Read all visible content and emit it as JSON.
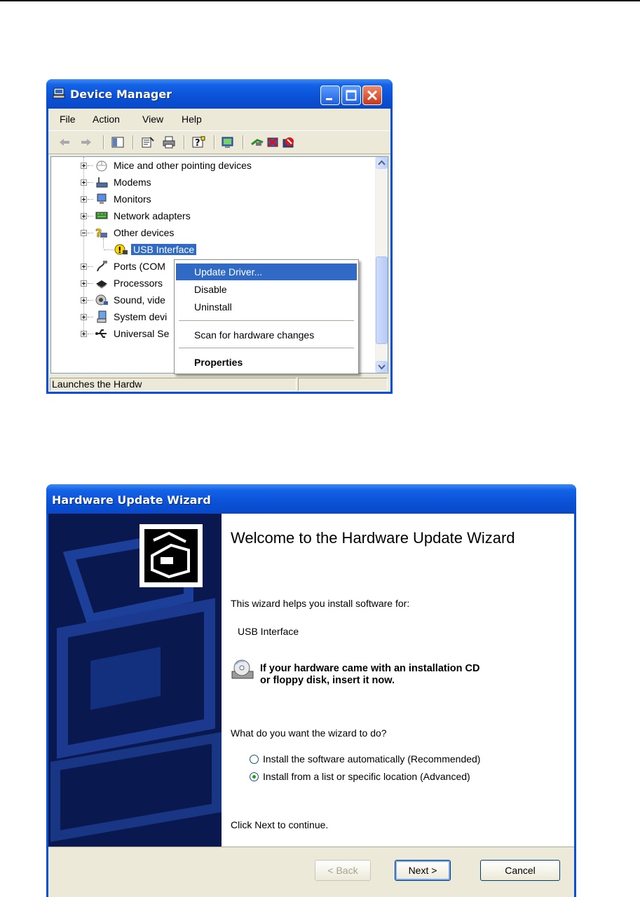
{
  "device_manager": {
    "title": "Device Manager",
    "menu": [
      "File",
      "Action",
      "View",
      "Help"
    ],
    "tree": [
      {
        "label": "Mice and other pointing devices",
        "icon": "mouse-icon"
      },
      {
        "label": "Modems",
        "icon": "modem-icon"
      },
      {
        "label": "Monitors",
        "icon": "monitor-icon"
      },
      {
        "label": "Network adapters",
        "icon": "network-adapter-icon"
      },
      {
        "label": "Other devices",
        "icon": "question-device-icon",
        "expanded": true
      },
      {
        "label": "USB Interface",
        "icon": "warning-device-icon",
        "child": true,
        "selected": true
      },
      {
        "label": "Ports (COM",
        "icon": "port-icon"
      },
      {
        "label": "Processors",
        "icon": "processor-icon"
      },
      {
        "label": "Sound, vide",
        "icon": "sound-icon"
      },
      {
        "label": "System devi",
        "icon": "system-device-icon"
      },
      {
        "label": "Universal Se",
        "icon": "usb-icon"
      }
    ],
    "status": "Launches the Hardw",
    "context_menu": {
      "items": [
        {
          "label": "Update Driver...",
          "highlighted": true
        },
        {
          "label": "Disable"
        },
        {
          "label": "Uninstall"
        },
        {
          "label": "Scan for hardware changes"
        },
        {
          "label": "Properties",
          "bold": true
        }
      ]
    }
  },
  "wizard": {
    "title": "Hardware Update Wizard",
    "heading": "Welcome to the Hardware Update Wizard",
    "intro": "This wizard helps you install software for:",
    "device": "USB Interface",
    "cd_line1": "If your hardware came with an installation CD",
    "cd_line2": "or floppy disk, insert it now.",
    "question": "What do you want the wizard to do?",
    "option_auto": "Install the software automatically (Recommended)",
    "option_list": "Install from a list or specific location (Advanced)",
    "selected_option": "option_list",
    "continue": "Click Next to continue.",
    "buttons": {
      "back": "< Back",
      "next": "Next >",
      "cancel": "Cancel"
    }
  },
  "colors": {
    "titlebar": "#0a52d7",
    "selection": "#316ac5",
    "dialog_bg": "#ece9d8"
  }
}
